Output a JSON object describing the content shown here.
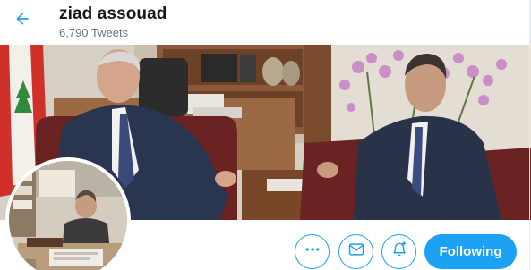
{
  "header": {
    "name": "ziad assouad",
    "tweet_count": "6,790 Tweets",
    "back_icon": "arrow-left-icon"
  },
  "banner": {
    "description_icon": "banner-photo"
  },
  "actions": {
    "more_icon": "more-dots-icon",
    "message_icon": "envelope-icon",
    "notify_icon": "bell-plus-icon",
    "following_label": "Following"
  },
  "colors": {
    "accent": "#1da1f2",
    "name_text": "#14171a",
    "secondary_text": "#657786"
  }
}
